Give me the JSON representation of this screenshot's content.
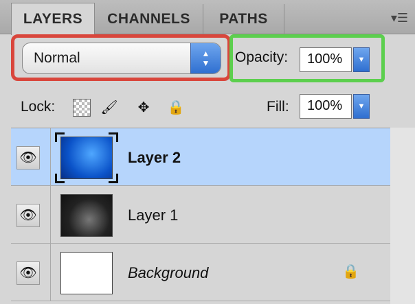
{
  "tabs": [
    {
      "label": "LAYERS",
      "active": true
    },
    {
      "label": "CHANNELS",
      "active": false
    },
    {
      "label": "PATHS",
      "active": false
    }
  ],
  "panel_menu_icon": "panel-menu-icon",
  "blend_mode": {
    "value": "Normal"
  },
  "opacity": {
    "label": "Opacity:",
    "value": "100%"
  },
  "lock": {
    "label": "Lock:"
  },
  "fill": {
    "label": "Fill:",
    "value": "100%"
  },
  "layers": [
    {
      "name": "Layer 2",
      "selected": true,
      "visible": true
    },
    {
      "name": "Layer 1",
      "selected": false,
      "visible": true
    },
    {
      "name": "Background",
      "selected": false,
      "visible": true,
      "locked": true
    }
  ],
  "colors": {
    "selection": "#b6d5fc",
    "highlight_red": "#d9463c",
    "highlight_green": "#5ccf4e",
    "accent_blue": "#2f6fd0"
  }
}
